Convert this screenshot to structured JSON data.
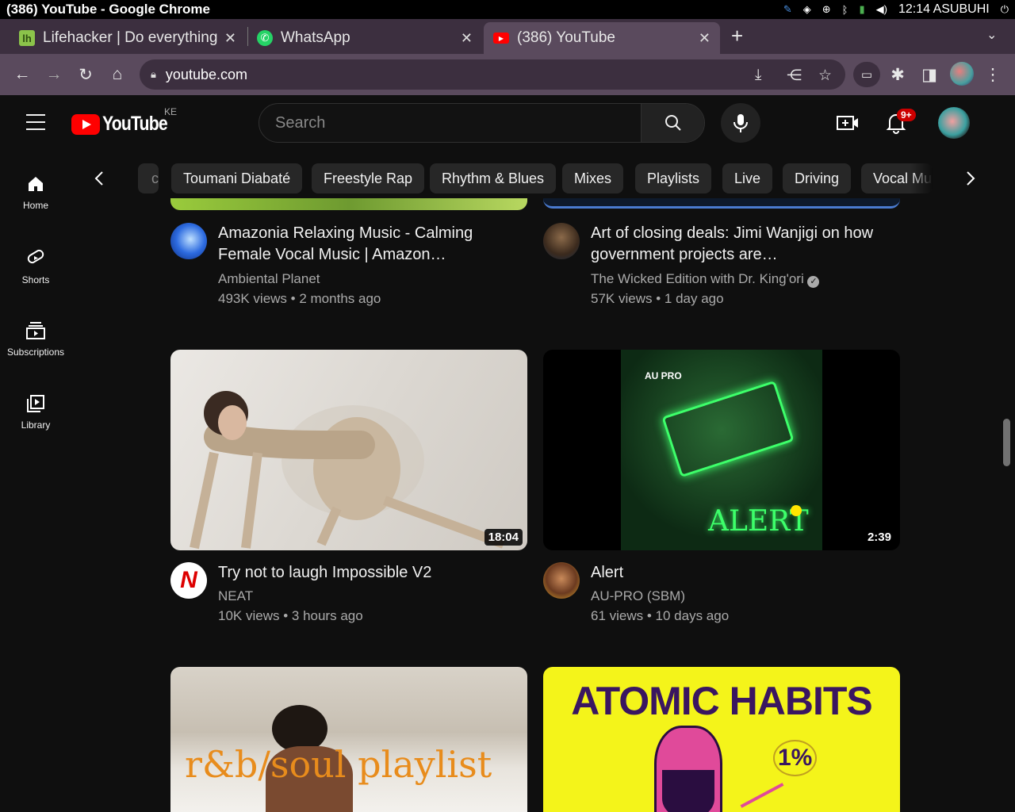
{
  "os": {
    "window_title": "(386) YouTube - Google Chrome",
    "clock": "12:14 ASUBUHI"
  },
  "browser": {
    "tabs": [
      {
        "title": "Lifehacker | Do everything better",
        "favicon": "lifehacker-icon",
        "fav_letter": "lh",
        "color": "#8bc34a"
      },
      {
        "title": "WhatsApp",
        "favicon": "whatsapp-icon",
        "color": "#25d366"
      },
      {
        "title": "(386) YouTube",
        "favicon": "youtube-icon",
        "color": "#ff0000",
        "active": true
      }
    ],
    "url": "youtube.com"
  },
  "youtube": {
    "logo_text": "YouTube",
    "country_code": "KE",
    "search_placeholder": "Search",
    "notification_count": "9+",
    "guide": [
      {
        "label": "Home",
        "icon": "home-icon"
      },
      {
        "label": "Shorts",
        "icon": "shorts-icon"
      },
      {
        "label": "Subscriptions",
        "icon": "subscriptions-icon"
      },
      {
        "label": "Library",
        "icon": "library-icon"
      }
    ],
    "chips": [
      "c",
      "Toumani Diabaté",
      "Freestyle Rap",
      "Rhythm & Blues",
      "Mixes",
      "Playlists",
      "Live",
      "Driving",
      "Vocal Mu"
    ],
    "videos": [
      {
        "title": "Amazonia Relaxing Music - Calming Female Vocal Music | Amazon…",
        "channel": "Ambiental Planet",
        "views": "493K views",
        "age": "2 months ago",
        "verified": false
      },
      {
        "title": "Art of closing deals: Jimi Wanjigi on how government projects are…",
        "channel": "The Wicked Edition with Dr. King'ori",
        "views": "57K views",
        "age": "1 day ago",
        "verified": true
      },
      {
        "title": "Try not to laugh Impossible V2",
        "channel": "NEAT",
        "views": "10K views",
        "age": "3 hours ago",
        "duration": "18:04",
        "verified": false
      },
      {
        "title": "Alert",
        "channel": "AU-PRO (SBM)",
        "views": "61 views",
        "age": "10 days ago",
        "duration": "2:39",
        "verified": false,
        "thumb_text_top": "AU PRO",
        "thumb_text_main": "ALERT"
      },
      {
        "thumb_text": "r&b/soul playlist"
      },
      {
        "thumb_text": "ATOMIC HABITS",
        "thumb_badge": "1%"
      }
    ]
  },
  "colors": {
    "bg": "#0f0f0f",
    "chip_bg": "#272727",
    "tabstrip": "#3c2f3f",
    "toolbar": "#5a4a5d",
    "yt_red": "#ff0000"
  }
}
